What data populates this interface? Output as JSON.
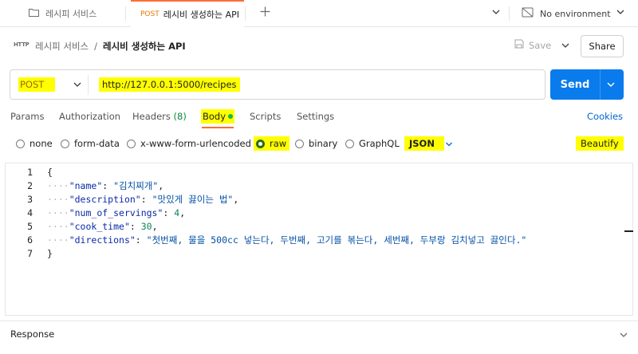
{
  "tabs": [
    {
      "label": "레시피 서비스",
      "icon": "folder-icon"
    },
    {
      "method": "POST",
      "label": "레시비 생성하는 API"
    }
  ],
  "environment": {
    "label": "No environment",
    "icon": "no-environment-icon"
  },
  "breadcrumb": {
    "parent": "레시피 서비스",
    "separator": "/",
    "current": "레시비 생성하는 API",
    "icon_text": "HTTP"
  },
  "actions": {
    "save_label": "Save",
    "share_label": "Share"
  },
  "request": {
    "method": "POST",
    "url": "http://127.0.0.1:5000/recipes",
    "send_label": "Send"
  },
  "request_tabs": [
    {
      "label": "Params"
    },
    {
      "label": "Authorization"
    },
    {
      "label": "Headers",
      "count": "(8)"
    },
    {
      "label": "Body",
      "active": true
    },
    {
      "label": "Scripts"
    },
    {
      "label": "Settings"
    }
  ],
  "cookies_label": "Cookies",
  "body_options": {
    "modes": [
      "none",
      "form-data",
      "x-www-form-urlencoded",
      "raw",
      "binary",
      "GraphQL"
    ],
    "selected": "raw",
    "language": "JSON",
    "beautify_label": "Beautify"
  },
  "editor": {
    "line_numbers": [
      "1",
      "2",
      "3",
      "4",
      "5",
      "6",
      "7"
    ],
    "body": {
      "open": "{",
      "close": "}",
      "fields": [
        {
          "key": "\"name\"",
          "value": "\"김치찌개\"",
          "trail": ","
        },
        {
          "key": "\"description\"",
          "value": "\"맛있게 끓이는 법\"",
          "trail": ","
        },
        {
          "key": "\"num_of_servings\"",
          "value": "4",
          "trail": ","
        },
        {
          "key": "\"cook_time\"",
          "value": "30",
          "trail": ","
        },
        {
          "key": "\"directions\"",
          "value": "\"첫번째, 물을 500cc 넣는다, 두번째, 고기를 볶는다, 세번째, 두부랑 김치넣고 끓인다.\"",
          "trail": ""
        }
      ]
    }
  },
  "response": {
    "label": "Response"
  },
  "colors": {
    "accent": "#ff6c37",
    "send": "#097bed",
    "highlight": "#ffff00",
    "link": "#0265d2"
  }
}
